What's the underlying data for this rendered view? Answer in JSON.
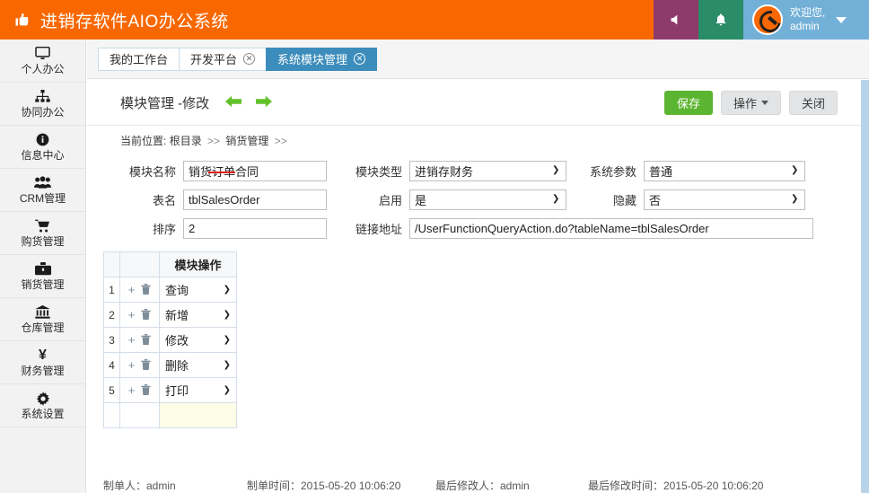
{
  "header": {
    "brand_icon": "thumbs-up-icon",
    "brand_title": "进销存软件AIO办公系统",
    "speaker_icon": "◀",
    "bell_icon": "🔔",
    "welcome_line1": "欢迎您,",
    "welcome_line2": "admin",
    "colors": {
      "brand_orange": "#f96800",
      "purple": "#8e3a6a",
      "green": "#2a8c68",
      "user_blue": "#73b0d8"
    }
  },
  "sidebar": {
    "items": [
      {
        "icon": "monitor-icon",
        "label": "个人办公"
      },
      {
        "icon": "sitemap-icon",
        "label": "协同办公"
      },
      {
        "icon": "info-icon",
        "label": "信息中心"
      },
      {
        "icon": "users-icon",
        "label": "CRM管理"
      },
      {
        "icon": "cart-icon",
        "label": "购货管理"
      },
      {
        "icon": "briefcase-icon",
        "label": "销货管理"
      },
      {
        "icon": "bank-icon",
        "label": "仓库管理"
      },
      {
        "icon": "yen-icon",
        "label": "财务管理"
      },
      {
        "icon": "gear-icon",
        "label": "系统设置"
      }
    ]
  },
  "tabs": [
    {
      "label": "我的工作台",
      "closable": false,
      "active": false
    },
    {
      "label": "开发平台",
      "closable": true,
      "active": false
    },
    {
      "label": "系统模块管理",
      "closable": true,
      "active": true
    }
  ],
  "page": {
    "title": "模块管理 -修改",
    "prev_arrow": "◀",
    "next_arrow": "▶",
    "save_label": "保存",
    "action_label": "操作",
    "close_label": "关闭",
    "breadcrumb_prefix": "当前位置:",
    "breadcrumb_items": [
      "根目录",
      "销货管理",
      ""
    ],
    "breadcrumb_sep": ">>"
  },
  "form": {
    "module_name": {
      "label": "模块名称",
      "value": "销货订单合同",
      "strikethrough": "订单"
    },
    "module_type": {
      "label": "模块类型",
      "value": "进销存财务"
    },
    "sys_param": {
      "label": "系统参数",
      "value": "普通"
    },
    "table_name": {
      "label": "表名",
      "value": "tblSalesOrder"
    },
    "enabled": {
      "label": "启用",
      "value": "是"
    },
    "hidden": {
      "label": "隐藏",
      "value": "否"
    },
    "sort_order": {
      "label": "排序",
      "value": "2"
    },
    "link_url": {
      "label": "链接地址",
      "value": "/UserFunctionQueryAction.do?tableName=tblSalesOrder"
    }
  },
  "op_table": {
    "headers": [
      "",
      "",
      "模块操作"
    ],
    "add_icon": "+",
    "del_icon": "🗑",
    "rows": [
      {
        "index": "1",
        "operation": "查询"
      },
      {
        "index": "2",
        "operation": "新增"
      },
      {
        "index": "3",
        "operation": "修改"
      },
      {
        "index": "4",
        "operation": "删除"
      },
      {
        "index": "5",
        "operation": "打印"
      }
    ],
    "new_row": {
      "index": "",
      "operation": ""
    }
  },
  "footer": {
    "creator": "制单人：admin",
    "create_time": "制单时间：2015-05-20 10:06:20",
    "modifier": "最后修改人：admin",
    "modify_time": "最后修改时间：2015-05-20 10:06:20"
  }
}
